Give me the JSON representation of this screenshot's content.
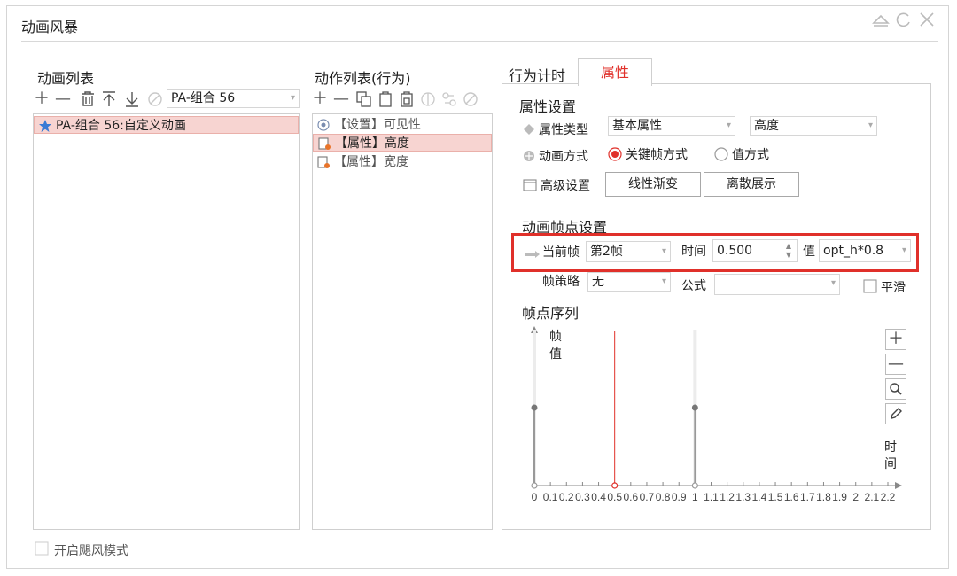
{
  "window": {
    "title": "动画风暴",
    "controls": [
      "minimize-icon",
      "restore-icon",
      "close-icon"
    ]
  },
  "animation_list": {
    "header": "动画列表",
    "combo_value": "PA-组合 56",
    "items": [
      {
        "label": "PA-组合 56:自定义动画",
        "selected": true
      }
    ]
  },
  "action_list": {
    "header": "动作列表(行为)",
    "items": [
      {
        "label": "【设置】可见性",
        "selected": false
      },
      {
        "label": "【属性】高度",
        "selected": true
      },
      {
        "label": "【属性】宽度",
        "selected": false
      }
    ]
  },
  "tabs": [
    {
      "label": "行为计时",
      "active": false
    },
    {
      "label": "属性",
      "active": true
    }
  ],
  "property": {
    "section_title": "属性设置",
    "type_label": "属性类型",
    "type_value": "基本属性",
    "type_value2": "高度",
    "mode_label": "动画方式",
    "mode_opt1": "关键帧方式",
    "mode_opt2": "值方式",
    "mode_selected": "关键帧方式",
    "adv_label": "高级设置",
    "btn_linear": "线性渐变",
    "btn_discrete": "离散展示"
  },
  "keyframe": {
    "section_title": "动画帧点设置",
    "current_label": "当前帧",
    "current_value": "第2帧",
    "time_label": "时间",
    "time_value": "0.500",
    "value_label": "值",
    "value_value": "opt_h*0.8",
    "strategy_label": "帧策略",
    "strategy_value": "无",
    "formula_label": "公式",
    "formula_value": "",
    "smooth_label": "平滑",
    "sequence_title": "帧点序列"
  },
  "chart_data": {
    "type": "scatter",
    "y_axis_label": "帧\n值",
    "x_axis_label": "时\n间",
    "x_ticks": [
      "0",
      "0.1",
      "0.2",
      "0.3",
      "0.4",
      "0.5",
      "0.6",
      "0.7",
      "0.8",
      "0.9",
      "1",
      "1.1",
      "1.2",
      "1.3",
      "1.4",
      "1.5",
      "1.6",
      "1.7",
      "1.8",
      "1.9",
      "2",
      "2.1",
      "2.2"
    ],
    "xlim": [
      0,
      2.2
    ],
    "keyframes": [
      {
        "time": 0,
        "selected": false
      },
      {
        "time": 0.5,
        "selected": true
      },
      {
        "time": 1,
        "selected": false
      }
    ]
  },
  "footer": {
    "checkbox_label": "开启飓风模式"
  },
  "colors": {
    "accent_red": "#e0302a",
    "selection_bg": "#f7d4d1"
  }
}
